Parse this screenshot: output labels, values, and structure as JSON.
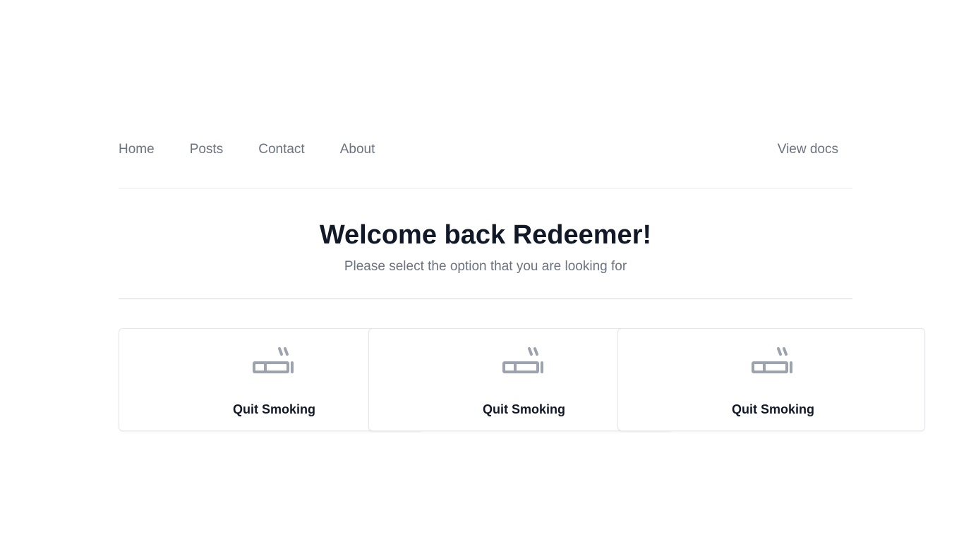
{
  "nav": {
    "links": [
      {
        "label": "Home"
      },
      {
        "label": "Posts"
      },
      {
        "label": "Contact"
      },
      {
        "label": "About"
      }
    ],
    "right_link": "View docs"
  },
  "hero": {
    "title": "Welcome back Redeemer!",
    "subtitle": "Please select the option that you are looking for"
  },
  "cards": [
    {
      "label": "Quit Smoking",
      "icon": "cigarette-icon"
    },
    {
      "label": "Quit Smoking",
      "icon": "cigarette-icon"
    },
    {
      "label": "Quit Smoking",
      "icon": "cigarette-icon"
    }
  ],
  "colors": {
    "icon": "#9ca3af",
    "text_muted": "#6b7280",
    "text_dark": "#111827"
  }
}
